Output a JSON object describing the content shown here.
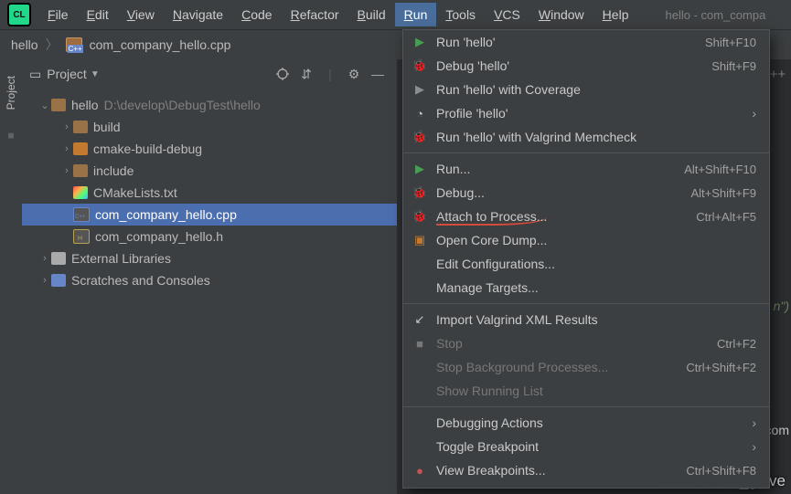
{
  "menubar": {
    "items": [
      "File",
      "Edit",
      "View",
      "Navigate",
      "Code",
      "Refactor",
      "Build",
      "Run",
      "Tools",
      "VCS",
      "Window",
      "Help"
    ],
    "active": "Run",
    "title": "hello - com_compa"
  },
  "breadcrumb": {
    "root": "hello",
    "file": "com_company_hello.cpp"
  },
  "project_header": {
    "label": "Project"
  },
  "tree": {
    "root": {
      "name": "hello",
      "path": "D:\\develop\\DebugTest\\hello"
    },
    "children": [
      {
        "type": "folder",
        "name": "build"
      },
      {
        "type": "folder-orange",
        "name": "cmake-build-debug"
      },
      {
        "type": "folder",
        "name": "include"
      },
      {
        "type": "cmake",
        "name": "CMakeLists.txt"
      },
      {
        "type": "cpp",
        "name": "com_company_hello.cpp",
        "selected": true
      },
      {
        "type": "h",
        "name": "com_company_hello.h"
      }
    ],
    "external": "External Libraries",
    "scratches": "Scratches and Consoles"
  },
  "editor": {
    "hint": "c++",
    "fragment1": "n\")",
    "fragment2": "com"
  },
  "run_menu": [
    {
      "icon": "play",
      "label": "Run 'hello'",
      "shortcut": "Shift+F10"
    },
    {
      "icon": "bug",
      "label": "Debug 'hello'",
      "shortcut": "Shift+F9"
    },
    {
      "icon": "cov",
      "label": "Run 'hello' with Coverage"
    },
    {
      "icon": "prof",
      "label": "Profile 'hello'",
      "sub": true
    },
    {
      "icon": "bug",
      "label": "Run 'hello' with Valgrind Memcheck"
    },
    {
      "sep": true
    },
    {
      "icon": "play",
      "label": "Run...",
      "shortcut": "Alt+Shift+F10"
    },
    {
      "icon": "bug",
      "label": "Debug...",
      "shortcut": "Alt+Shift+F9"
    },
    {
      "icon": "bug",
      "label": "Attach to Process...",
      "shortcut": "Ctrl+Alt+F5",
      "mark": true
    },
    {
      "icon": "core",
      "label": "Open Core Dump..."
    },
    {
      "label": "Edit Configurations..."
    },
    {
      "label": "Manage Targets..."
    },
    {
      "sep": true
    },
    {
      "icon": "import",
      "label": "Import Valgrind XML Results"
    },
    {
      "icon": "stop",
      "label": "Stop",
      "shortcut": "Ctrl+F2",
      "disabled": true
    },
    {
      "label": "Stop Background Processes...",
      "shortcut": "Ctrl+Shift+F2",
      "disabled": true
    },
    {
      "label": "Show Running List",
      "disabled": true
    },
    {
      "sep": true
    },
    {
      "label": "Debugging Actions",
      "sub": true
    },
    {
      "label": "Toggle Breakpoint",
      "sub": true
    },
    {
      "icon": "bp",
      "label": "View Breakpoints...",
      "shortcut": "Ctrl+Shift+F8"
    }
  ],
  "watermark": "CSDN @zx_glave"
}
